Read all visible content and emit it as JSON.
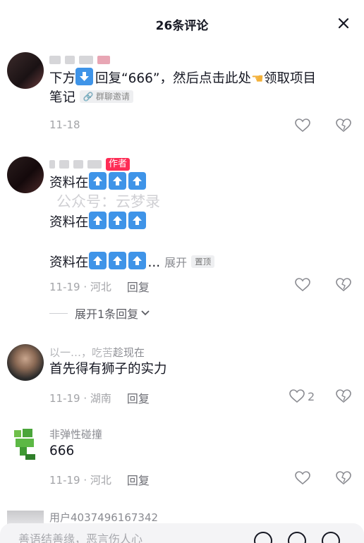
{
  "header": {
    "title": "26条评论",
    "close_icon": "close-icon"
  },
  "watermark": "公众号：云梦录",
  "comments": [
    {
      "tag": "",
      "text_a": "下方",
      "text_b": "回复“666”，然后点击此处",
      "text_c": "领取项目",
      "text_d": "笔记",
      "link_pill": "群聊邀请",
      "date": "11-18",
      "like_count": ""
    },
    {
      "tag": "作者",
      "line1": "资料在",
      "line2": "资料在",
      "line3": "资料在",
      "ellipsis": "...",
      "expand_label": "展开",
      "pinned_label": "置顶",
      "date_location": "11-19 · 河北",
      "reply_label": "回复",
      "expand_replies": "展开1条回复"
    },
    {
      "username": "趁现在",
      "username_prefix": "以一…，吃苦",
      "text": "首先得有狮子的实力",
      "date_location": "11-19 · 湖南",
      "reply_label": "回复",
      "like_count": "2"
    },
    {
      "username": "非弹性碰撞",
      "text": "666",
      "date_location": "11-19 · 河北",
      "reply_label": "回复"
    },
    {
      "username": "用户4037496167342"
    }
  ],
  "input": {
    "placeholder": "善语结善缘，恶言伤人心"
  },
  "colors": {
    "accent": "#fe2c55",
    "emoji_blue": "#3f94e8",
    "text": "#161823",
    "muted": "#a3a4a8"
  }
}
